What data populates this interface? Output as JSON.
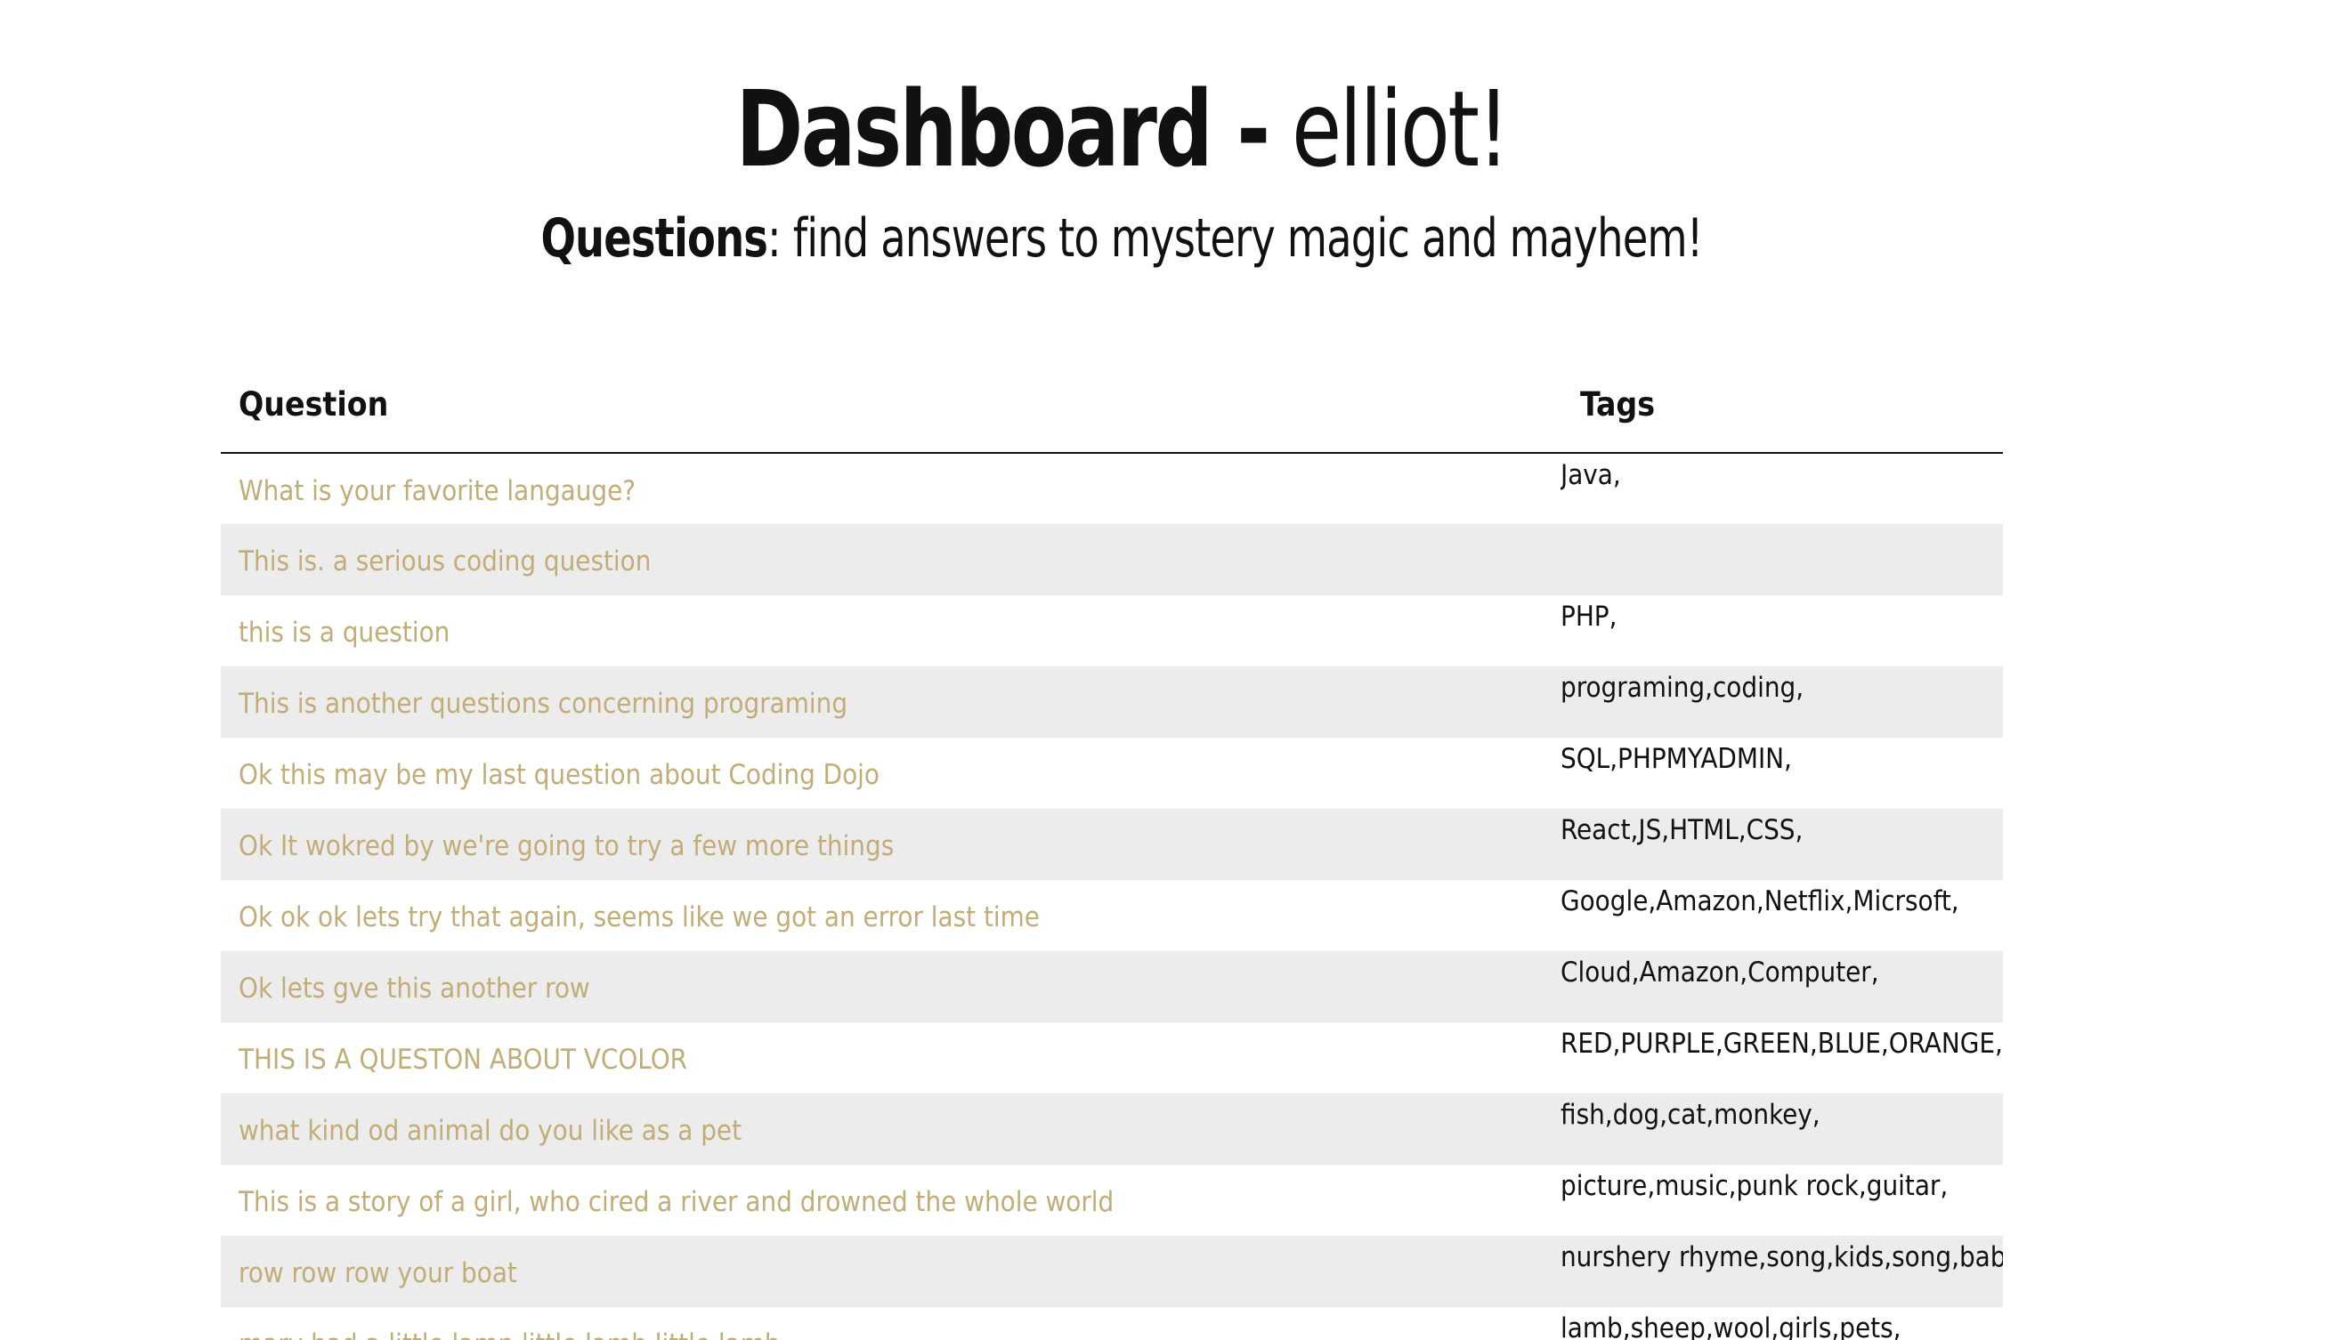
{
  "header": {
    "title_bold": "Dashboard -",
    "title_user": "elliot!",
    "subtitle_bold": "Questions",
    "subtitle_rest": ": find answers to mystery magic and mayhem!"
  },
  "table": {
    "columns": {
      "question": "Question",
      "tags": "Tags"
    },
    "rows": [
      {
        "question": "What is your favorite langauge?",
        "tags": "Java,"
      },
      {
        "question": "This is. a serious coding question",
        "tags": ""
      },
      {
        "question": "this is a question",
        "tags": "PHP,"
      },
      {
        "question": "This is another questions concerning programing",
        "tags": "programing,coding,"
      },
      {
        "question": "Ok this may be my last question about Coding Dojo",
        "tags": "SQL,PHPMYADMIN,"
      },
      {
        "question": "Ok It wokred by we're going to try a few more things",
        "tags": "React,JS,HTML,CSS,"
      },
      {
        "question": "Ok ok ok lets try that again, seems like we got an error last time",
        "tags": "Google,Amazon,Netflix,Micrsoft,"
      },
      {
        "question": "Ok lets gve this another row",
        "tags": "Cloud,Amazon,Computer,"
      },
      {
        "question": "THIS IS A QUESTON ABOUT VCOLOR",
        "tags": "RED,PURPLE,GREEN,BLUE,ORANGE,"
      },
      {
        "question": "what kind od animal do you like as a pet",
        "tags": "fish,dog,cat,monkey,"
      },
      {
        "question": "This is a story of a girl, who cired a river and drowned the whole world",
        "tags": "picture,music,punk rock,guitar,"
      },
      {
        "question": "row row row your boat",
        "tags": "nurshery rhyme,song,kids,song,babies,"
      },
      {
        "question": "mary had a little lamp little lamb little lamb",
        "tags": "lamb,sheep,wool,girls,pets,"
      }
    ]
  },
  "colors": {
    "link": "#c2ac77",
    "stripe": "#ececec",
    "text": "#111111"
  }
}
